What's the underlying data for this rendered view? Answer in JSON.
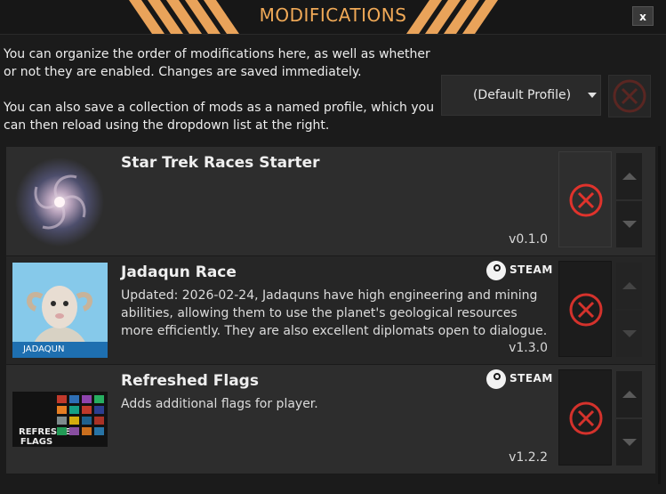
{
  "window": {
    "title": "MODIFICATIONS",
    "close_label": "x"
  },
  "intro": {
    "paragraph_1": "You can organize the order of modifications here, as well as whether or not they are enabled. Changes are saved immediately.",
    "paragraph_2": "You can also save a collection of mods as a named profile, which you can then reload using the dropdown list at the right."
  },
  "profile": {
    "selected": "(Default Profile)"
  },
  "colors": {
    "accent": "#f0a957",
    "delete_red": "#e0332c",
    "background": "#1b1b1b"
  },
  "mods": [
    {
      "name": "Star Trek Races Starter",
      "description": "",
      "version": "v0.1.0",
      "steam": false,
      "thumbnail": "spiral-galaxy"
    },
    {
      "name": "Jadaqun Race",
      "description": "Updated: 2026-02-24, Jadaquns have high engineering and mining abilities, allowing them to use the planet's geological resources more efficiently. They are also excellent diplomats open to dialogue.",
      "version": "v1.3.0",
      "steam": true,
      "steam_label": "STEAM",
      "thumbnail": "jadaqun-portrait",
      "thumbnail_caption": "JADAQUN"
    },
    {
      "name": "Refreshed Flags",
      "description": "Adds additional flags for player.",
      "version": "v1.2.2",
      "steam": true,
      "steam_label": "STEAM",
      "thumbnail": "flags-grid",
      "thumbnail_caption": "REFRESHED FLAGS"
    }
  ]
}
